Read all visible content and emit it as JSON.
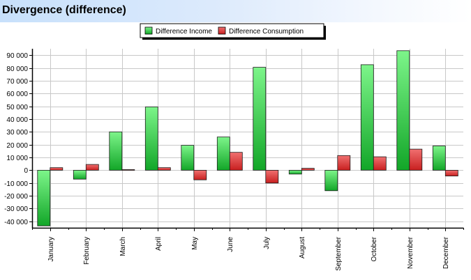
{
  "window": {
    "title": "Divergence (difference)"
  },
  "chart_data": {
    "type": "bar",
    "title": "Divergence (difference)",
    "xlabel": "",
    "ylabel": "",
    "categories": [
      "January",
      "February",
      "March",
      "April",
      "May",
      "June",
      "July",
      "August",
      "September",
      "October",
      "November",
      "December"
    ],
    "series": [
      {
        "name": "Difference Income",
        "color": "#2ecc3e",
        "values": [
          -43500,
          -7000,
          30000,
          49500,
          19500,
          26000,
          80500,
          -3000,
          -16000,
          82500,
          93500,
          19000
        ]
      },
      {
        "name": "Difference Consumption",
        "color": "#e03a3a",
        "values": [
          2000,
          4500,
          500,
          2000,
          -7500,
          14000,
          -10000,
          1500,
          11500,
          10500,
          16500,
          -4500
        ]
      }
    ],
    "ylim": [
      -45000,
      95000
    ],
    "yticks": [
      -40000,
      -30000,
      -20000,
      -10000,
      0,
      10000,
      20000,
      30000,
      40000,
      50000,
      60000,
      70000,
      80000,
      90000
    ],
    "ytick_labels": [
      "-40 000",
      "-30 000",
      "-20 000",
      "-10 000",
      "0",
      "10 000",
      "20 000",
      "30 000",
      "40 000",
      "50 000",
      "60 000",
      "70 000",
      "80 000",
      "90 000"
    ],
    "grid": true,
    "legend_position": "top-center"
  }
}
